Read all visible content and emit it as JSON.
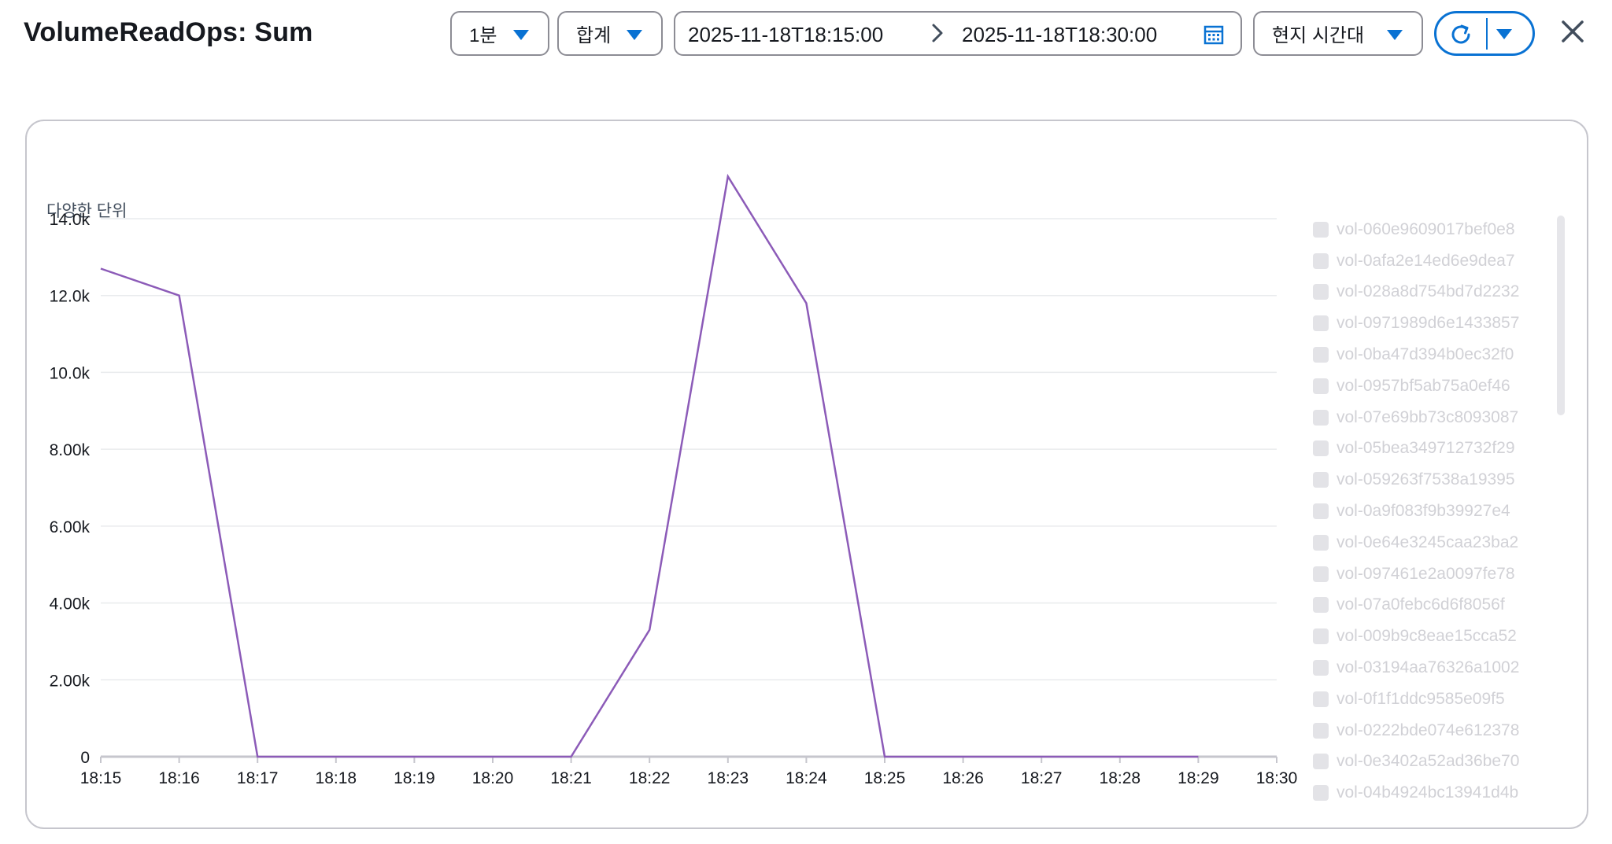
{
  "header": {
    "title": "VolumeReadOps: Sum",
    "period": "1분",
    "statistic": "합계",
    "range_start": "2025-11-18T18:15:00",
    "range_end": "2025-11-18T18:30:00",
    "timezone": "현지 시간대",
    "icons": {
      "period_caret": "caret-down-icon",
      "range_arrow": "chevron-right-icon",
      "calendar": "calendar-icon",
      "refresh": "refresh-icon",
      "close": "close-icon"
    }
  },
  "colors": {
    "accent": "#0972d3",
    "series_line": "#8c5bb8",
    "gridline": "#e9ebed",
    "legend_text": "#d1d1d6"
  },
  "legend": {
    "items": [
      "vol-060e9609017bef0e8",
      "vol-0afa2e14ed6e9dea7",
      "vol-028a8d754bd7d2232",
      "vol-0971989d6e1433857",
      "vol-0ba47d394b0ec32f0",
      "vol-0957bf5ab75a0ef46",
      "vol-07e69bb73c8093087",
      "vol-05bea349712732f29",
      "vol-059263f7538a19395",
      "vol-0a9f083f9b39927e4",
      "vol-0e64e3245caa23ba2",
      "vol-097461e2a0097fe78",
      "vol-07a0febc6d6f8056f",
      "vol-009b9c8eae15cca52",
      "vol-03194aa76326a1002",
      "vol-0f1f1ddc9585e09f5",
      "vol-0222bde074e612378",
      "vol-0e3402a52ad36be70",
      "vol-04b4924bc13941d4b"
    ]
  },
  "chart_data": {
    "type": "line",
    "ylabel": "다양한 단위",
    "x": [
      "18:15",
      "18:16",
      "18:17",
      "18:18",
      "18:19",
      "18:20",
      "18:21",
      "18:22",
      "18:23",
      "18:24",
      "18:25",
      "18:26",
      "18:27",
      "18:28",
      "18:29",
      "18:30"
    ],
    "ylim": [
      0,
      16000
    ],
    "yticks": [
      0,
      2000,
      4000,
      6000,
      8000,
      10000,
      12000,
      14000
    ],
    "ytick_labels": [
      "0",
      "2.00k",
      "4.00k",
      "6.00k",
      "8.00k",
      "10.0k",
      "12.0k",
      "14.0k"
    ],
    "grid": true,
    "legend_position": "right",
    "series": [
      {
        "values": [
          12700,
          12000,
          0,
          0,
          0,
          0,
          0,
          3300,
          15100,
          11800,
          0,
          0,
          0,
          0,
          0,
          null
        ],
        "color": "#8c5bb8"
      }
    ]
  }
}
